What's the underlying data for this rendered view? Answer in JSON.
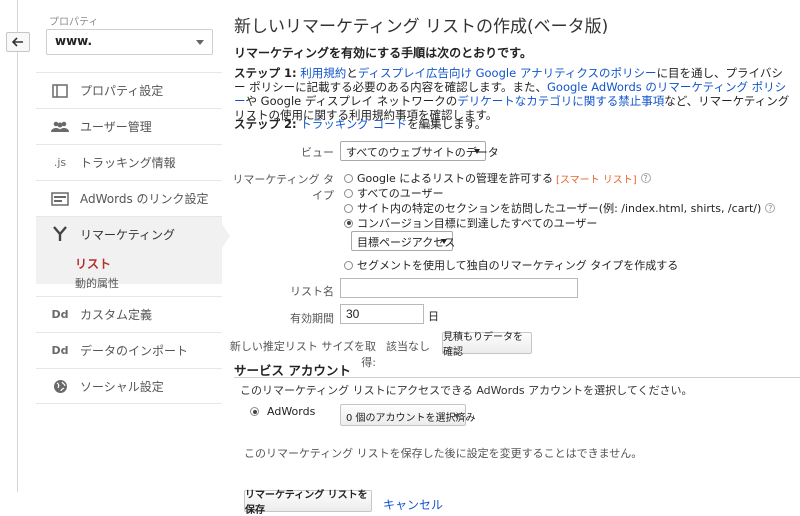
{
  "sidebar": {
    "property_label": "プロパティ",
    "property_value": "www.",
    "items": [
      {
        "label": "プロパティ設定",
        "icon": "property-settings-icon"
      },
      {
        "label": "ユーザー管理",
        "icon": "users-icon"
      },
      {
        "label": "トラッキング情報",
        "icon": "js-icon",
        "glyph": ".js"
      },
      {
        "label": "AdWords のリンク設定",
        "icon": "adwords-link-icon"
      },
      {
        "label": "リマーケティング",
        "icon": "remarketing-icon"
      },
      {
        "label": "カスタム定義",
        "icon": "dd-icon",
        "glyph": "Dd"
      },
      {
        "label": "データのインポート",
        "icon": "dd-icon",
        "glyph": "Dd"
      },
      {
        "label": "ソーシャル設定",
        "icon": "globe-icon"
      }
    ],
    "remarketing_sub": {
      "list": "リスト",
      "dynamic": "動的属性"
    }
  },
  "page": {
    "title": "新しいリマーケティング リストの作成(ベータ版)",
    "intro": "リマーケティングを有効にする手順は次のとおりです。",
    "step1": {
      "label": "ステップ 1:",
      "link1": "利用規約",
      "t1": "と",
      "link2": "ディスプレイ広告向け Google アナリティクスのポリシー",
      "t2": "に目を通し、プライバシー ポリシーに記載する必要のある内容を確認します。また、",
      "link3": "Google AdWords のリマーケティング ポリシー",
      "t3": "や Google ディスプレイ ネットワークの",
      "link4": "デリケートなカテゴリに関する禁止事項",
      "t4": "など、リマーケティング リストの使用に関する利用規約事項を確認します。"
    },
    "step2": {
      "label": "ステップ 2:",
      "link": "トラッキング コード",
      "text": "を編集します。"
    }
  },
  "form": {
    "view_label": "ビュー",
    "view_value": "すべてのウェブサイトのデータ",
    "type_label": "リマーケティング タイプ",
    "options": [
      {
        "label": "Google によるリストの管理を許可する",
        "badge": "[スマート リスト]",
        "help": "?"
      },
      {
        "label": "すべてのユーザー"
      },
      {
        "label": "サイト内の特定のセクションを訪問したユーザー(例: /index.html, shirts, /cart/)",
        "help": "?"
      },
      {
        "label": "コンバージョン目標に到達したすべてのユーザー"
      },
      {
        "label": "セグメントを使用して独自のリマーケティング タイプを作成する"
      }
    ],
    "goal_select": "目標ページアクセス",
    "list_name_label": "リスト名",
    "list_name_value": "",
    "duration_label": "有効期間",
    "duration_value": "30",
    "duration_unit": "日",
    "estimate_label": "新しい推定リスト サイズを取得:",
    "estimate_value": "該当なし",
    "estimate_button": "見積もりデータを確認"
  },
  "service": {
    "title": "サービス アカウント",
    "desc": "このリマーケティング リストにアクセスできる AdWords アカウントを選択してください。",
    "adwords_label": "AdWords",
    "account_select": "0 個のアカウントを選択済み",
    "note": "このリマーケティング リストを保存した後に設定を変更することはできません。"
  },
  "actions": {
    "save": "リマーケティング リストを保存",
    "cancel": "キャンセル"
  }
}
